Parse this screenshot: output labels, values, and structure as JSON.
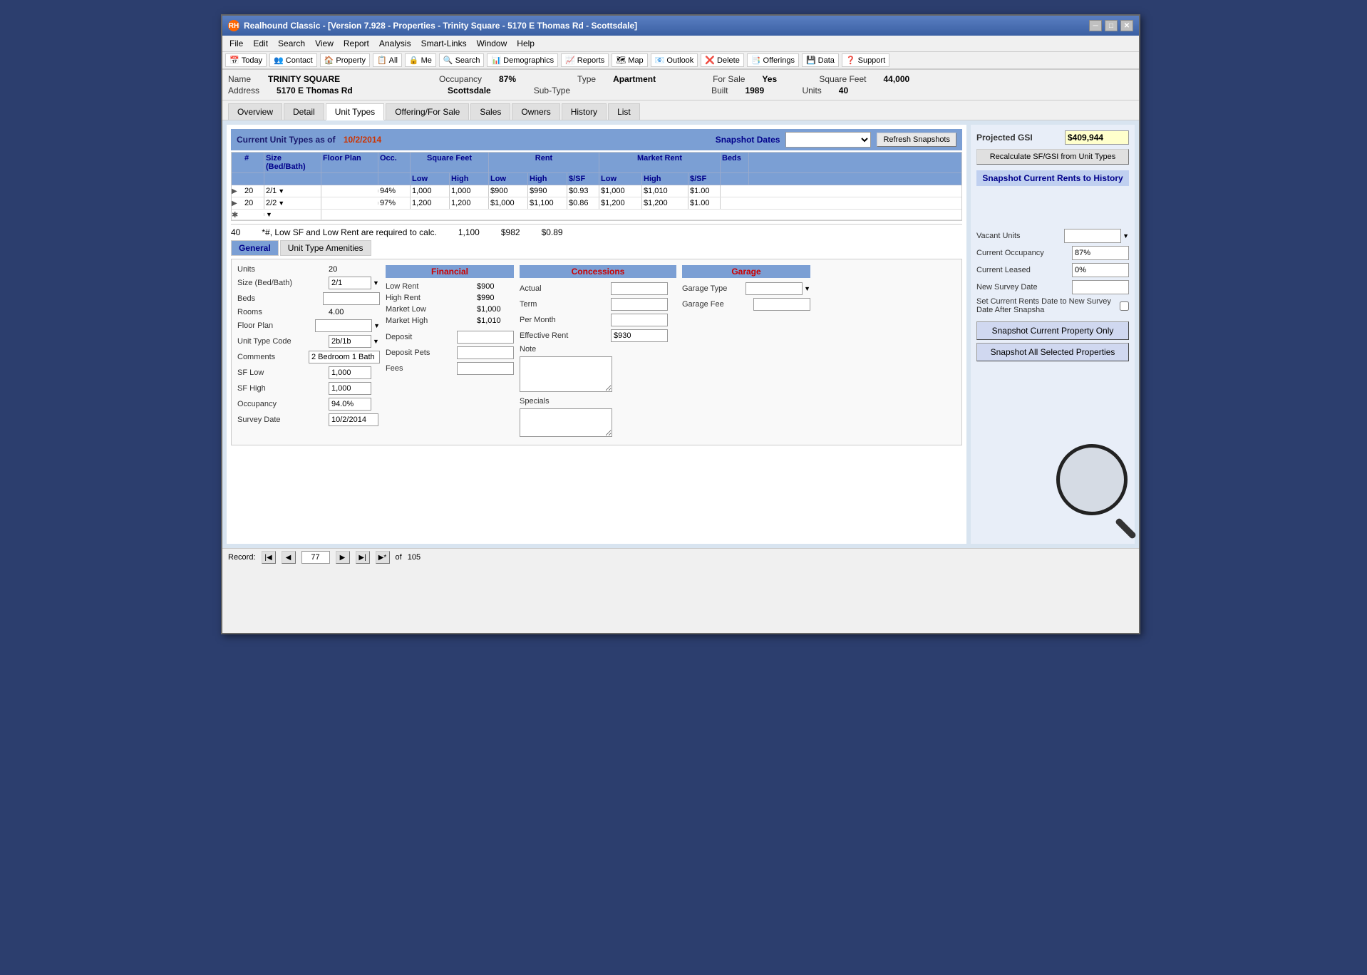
{
  "window": {
    "title": "Realhound Classic - [Version 7.928 - Properties - Trinity Square - 5170 E Thomas Rd - Scottsdale]",
    "icon": "RH"
  },
  "menubar": {
    "items": [
      "File",
      "Edit",
      "Search",
      "View",
      "Report",
      "Analysis",
      "Smart-Links",
      "Window",
      "Help"
    ]
  },
  "toolbar": {
    "items": [
      {
        "label": "Today",
        "icon": "📅"
      },
      {
        "label": "Contact",
        "icon": "👥"
      },
      {
        "label": "Property",
        "icon": "🏠"
      },
      {
        "label": "All",
        "icon": "📋"
      },
      {
        "label": "Me",
        "icon": "🔒"
      },
      {
        "label": "Search",
        "icon": "🔍"
      },
      {
        "label": "Demographics",
        "icon": "📊"
      },
      {
        "label": "Reports",
        "icon": "📈"
      },
      {
        "label": "Map",
        "icon": "🗺"
      },
      {
        "label": "Outlook",
        "icon": "📧"
      },
      {
        "label": "Delete",
        "icon": "❌"
      },
      {
        "label": "Offerings",
        "icon": "📑"
      },
      {
        "label": "Data",
        "icon": "💾"
      },
      {
        "label": "Support",
        "icon": "❓"
      }
    ]
  },
  "property": {
    "name_label": "Name",
    "name_value": "TRINITY SQUARE",
    "address_label": "Address",
    "address_value": "5170 E Thomas Rd",
    "occupancy_label": "Occupancy",
    "occupancy_value": "87%",
    "city_value": "Scottsdale",
    "type_label": "Type",
    "type_value": "Apartment",
    "subtype_label": "Sub-Type",
    "subtype_value": "",
    "forsale_label": "For Sale",
    "forsale_value": "Yes",
    "built_label": "Built",
    "built_value": "1989",
    "sqft_label": "Square Feet",
    "sqft_value": "44,000",
    "units_label": "Units",
    "units_value": "40"
  },
  "tabs": {
    "items": [
      "Overview",
      "Detail",
      "Unit Types",
      "Offering/For Sale",
      "Sales",
      "Owners",
      "History",
      "List"
    ],
    "active": "Unit Types"
  },
  "unit_types_section": {
    "header_label": "Current Unit Types as of",
    "header_date": "10/2/2014",
    "snapshot_dates_label": "Snapshot Dates",
    "refresh_btn": "Refresh Snapshots",
    "projected_gsi_label": "Projected GSI",
    "projected_gsi_value": "$409,944",
    "recalculate_btn": "Recalculate SF/GSI from Unit Types",
    "snapshot_rents_label": "Snapshot Current Rents to History"
  },
  "grid": {
    "headers": {
      "hash": "#",
      "size": "Size (Bed/Bath)",
      "floor_plan": "Floor Plan",
      "occ": "Occ.",
      "square_feet": "Square Feet",
      "sf_low": "Low",
      "sf_high": "High",
      "rent": "Rent",
      "rent_low": "Low",
      "rent_high": "High",
      "rent_sf": "$/SF",
      "market_rent": "Market Rent",
      "mr_low": "Low",
      "mr_high": "High",
      "mr_sf": "$/SF",
      "beds": "Beds"
    },
    "rows": [
      {
        "hash": "20",
        "size": "2/1",
        "floor_plan": "",
        "occ": "94%",
        "sf_low": "1,000",
        "sf_high": "1,000",
        "rent_low": "$900",
        "rent_high": "$990",
        "rent_sf": "$0.93",
        "mr_low": "$1,000",
        "mr_high": "$1,010",
        "mr_sf": "$1.00",
        "beds": ""
      },
      {
        "hash": "20",
        "size": "2/2",
        "floor_plan": "",
        "occ": "97%",
        "sf_low": "1,200",
        "sf_high": "1,200",
        "rent_low": "$1,000",
        "rent_high": "$1,100",
        "rent_sf": "$0.86",
        "mr_low": "$1,200",
        "mr_high": "$1,200",
        "mr_sf": "$1.00",
        "beds": ""
      }
    ]
  },
  "summary": {
    "total_units": "40",
    "note": "*#, Low SF and Low Rent are required to calc.",
    "avg_sf": "1,100",
    "avg_rent": "$982",
    "avg_sf_rent": "$0.89"
  },
  "form_tabs": {
    "general": "General",
    "amenities": "Unit Type Amenities",
    "active": "General"
  },
  "general_form": {
    "units_label": "Units",
    "units_value": "20",
    "size_label": "Size (Bed/Bath)",
    "size_value": "2/1",
    "beds_label": "Beds",
    "beds_value": "",
    "rooms_label": "Rooms",
    "rooms_value": "4.00",
    "floor_plan_label": "Floor Plan",
    "floor_plan_value": "",
    "unit_type_code_label": "Unit Type Code",
    "unit_type_code_value": "2b/1b",
    "comments_label": "Comments",
    "comments_value": "2 Bedroom 1 Bath",
    "sf_low_label": "SF Low",
    "sf_low_value": "1,000",
    "sf_high_label": "SF High",
    "sf_high_value": "1,000",
    "occupancy_label": "Occupancy",
    "occupancy_value": "94.0%",
    "survey_date_label": "Survey Date",
    "survey_date_value": "10/2/2014"
  },
  "financial_form": {
    "section_label": "Financial",
    "low_rent_label": "Low Rent",
    "low_rent_value": "$900",
    "high_rent_label": "High Rent",
    "high_rent_value": "$990",
    "market_low_label": "Market Low",
    "market_low_value": "$1,000",
    "market_high_label": "Market High",
    "market_high_value": "$1,010",
    "deposit_label": "Deposit",
    "deposit_value": "",
    "deposit_pets_label": "Deposit Pets",
    "deposit_pets_value": "",
    "fees_label": "Fees",
    "fees_value": ""
  },
  "concessions_form": {
    "section_label": "Concessions",
    "actual_label": "Actual",
    "actual_value": "",
    "term_label": "Term",
    "term_value": "",
    "per_month_label": "Per Month",
    "per_month_value": "",
    "effective_rent_label": "Effective Rent",
    "effective_rent_value": "$930",
    "note_label": "Note",
    "note_value": "",
    "specials_label": "Specials",
    "specials_value": ""
  },
  "garage_form": {
    "section_label": "Garage",
    "garage_type_label": "Garage Type",
    "garage_type_value": "",
    "garage_fee_label": "Garage Fee",
    "garage_fee_value": ""
  },
  "right_panel": {
    "vacant_units_label": "Vacant Units",
    "vacant_units_value": "",
    "current_occupancy_label": "Current Occupancy",
    "current_occupancy_value": "87%",
    "current_leased_label": "Current Leased",
    "current_leased_value": "0%",
    "new_survey_date_label": "New Survey Date",
    "new_survey_date_value": "",
    "set_rents_label": "Set Current Rents Date to New Survey Date After Snapsha",
    "snapshot_current_btn": "Snapshot Current Property Only",
    "snapshot_all_btn": "Snapshot All Selected Properties"
  },
  "status_bar": {
    "record_label": "Record:",
    "current_record": "77",
    "total_records": "105"
  }
}
